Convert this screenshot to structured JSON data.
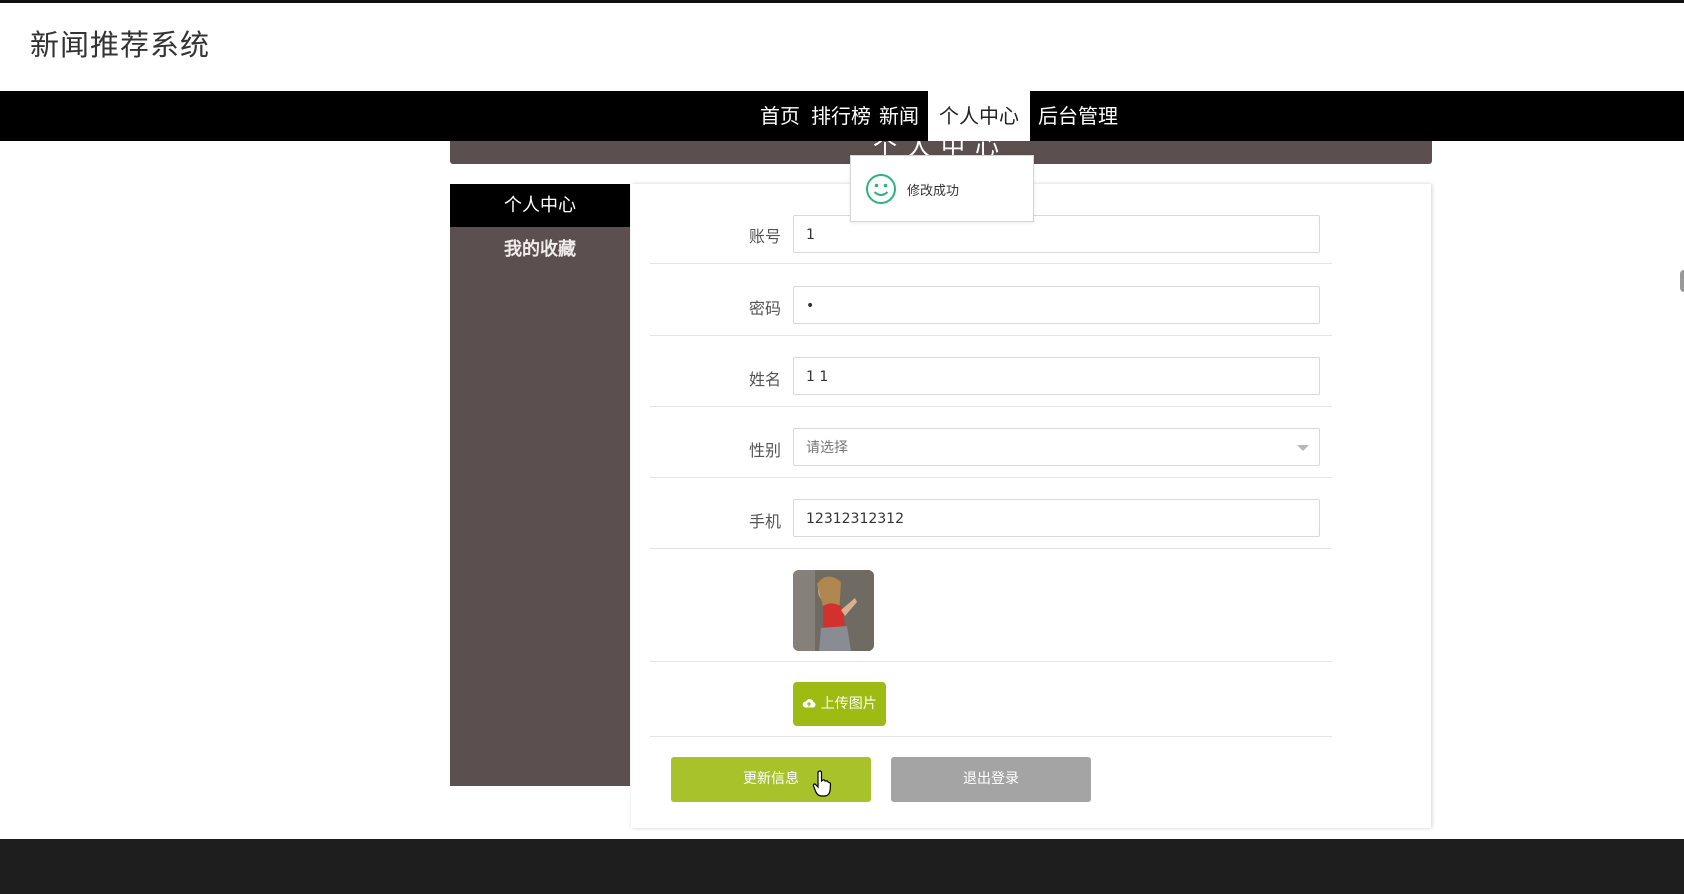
{
  "site": {
    "title": "新闻推荐系统"
  },
  "nav": {
    "items": [
      {
        "label": "首页"
      },
      {
        "label": "排行榜"
      },
      {
        "label": "新闻"
      },
      {
        "label": "个人中心",
        "active": true
      },
      {
        "label": "后台管理"
      }
    ]
  },
  "banner": {
    "title": "个人中心"
  },
  "toast": {
    "message": "修改成功",
    "icon": "smile-icon"
  },
  "sidebar": {
    "items": [
      {
        "label": "个人中心",
        "active": true
      },
      {
        "label": "我的收藏"
      }
    ]
  },
  "form": {
    "account": {
      "label": "账号",
      "value": "1"
    },
    "password": {
      "label": "密码",
      "value": "•"
    },
    "name": {
      "label": "姓名",
      "value": "1 1"
    },
    "gender": {
      "label": "性别",
      "placeholder": "请选择"
    },
    "phone": {
      "label": "手机",
      "value": "12312312312"
    },
    "upload_label": "上传图片"
  },
  "actions": {
    "update_label": "更新信息",
    "logout_label": "退出登录"
  },
  "colors": {
    "navbar": "#000000",
    "sidebar": "#5b504f",
    "accent_green": "#a8c22b",
    "toast_icon": "#2bb380",
    "logout_gray": "#a4a4a4",
    "footer": "#1e1e1e"
  }
}
